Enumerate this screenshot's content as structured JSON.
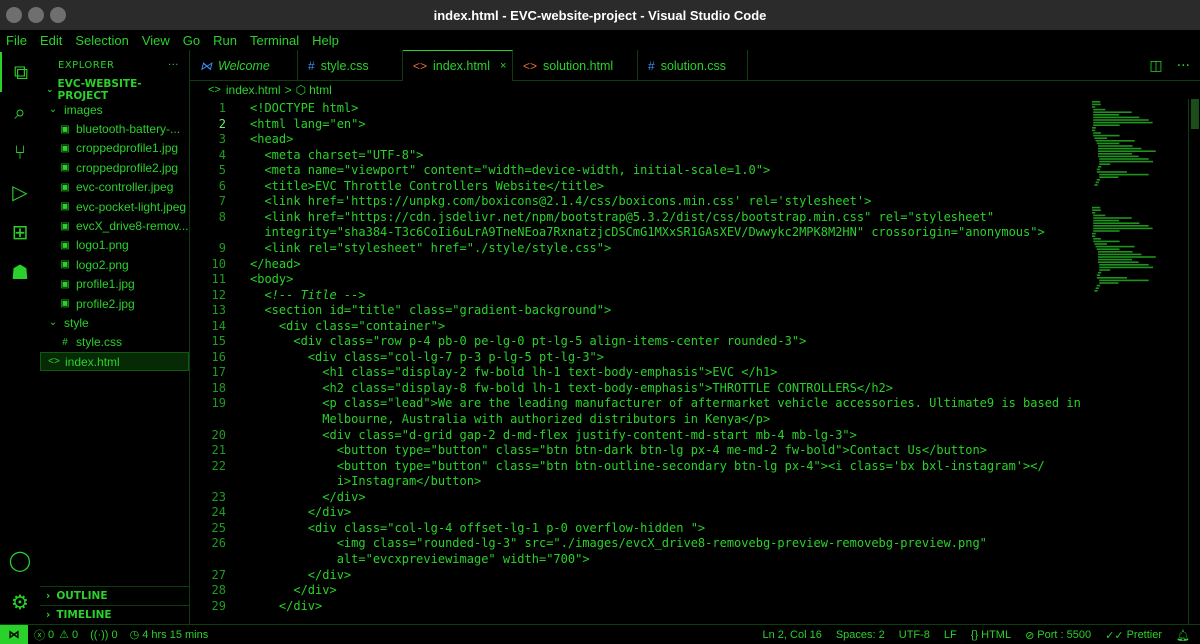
{
  "window": {
    "title": "index.html - EVC-website-project - Visual Studio Code"
  },
  "menu": [
    "File",
    "Edit",
    "Selection",
    "View",
    "Go",
    "Run",
    "Terminal",
    "Help"
  ],
  "activity": [
    {
      "name": "explorer-icon",
      "glyph": "⧉"
    },
    {
      "name": "search-icon",
      "glyph": "⌕"
    },
    {
      "name": "source-control-icon",
      "glyph": "⑂"
    },
    {
      "name": "run-debug-icon",
      "glyph": "▷"
    },
    {
      "name": "extensions-icon",
      "glyph": "⊞"
    },
    {
      "name": "alien-extension-icon",
      "glyph": "☗"
    }
  ],
  "activity_bottom": [
    {
      "name": "account-icon",
      "glyph": "◯"
    },
    {
      "name": "settings-gear-icon",
      "glyph": "⚙"
    }
  ],
  "sidebar": {
    "header": "EXPLORER",
    "more": "···",
    "project": "EVC-WEBSITE-PROJECT",
    "tree": [
      {
        "label": "images",
        "type": "folder",
        "depth": 1
      },
      {
        "label": "bluetooth-battery-...",
        "type": "image",
        "depth": 2
      },
      {
        "label": "croppedprofile1.jpg",
        "type": "image",
        "depth": 2
      },
      {
        "label": "croppedprofile2.jpg",
        "type": "image",
        "depth": 2
      },
      {
        "label": "evc-controller.jpeg",
        "type": "image",
        "depth": 2
      },
      {
        "label": "evc-pocket-light.jpeg",
        "type": "image",
        "depth": 2
      },
      {
        "label": "evcX_drive8-remov...",
        "type": "image",
        "depth": 2
      },
      {
        "label": "logo1.png",
        "type": "image",
        "depth": 2
      },
      {
        "label": "logo2.png",
        "type": "image",
        "depth": 2
      },
      {
        "label": "profile1.jpg",
        "type": "image",
        "depth": 2
      },
      {
        "label": "profile2.jpg",
        "type": "image",
        "depth": 2
      },
      {
        "label": "style",
        "type": "folder",
        "depth": 1
      },
      {
        "label": "style.css",
        "type": "css",
        "depth": 2
      },
      {
        "label": "index.html",
        "type": "html",
        "depth": 1,
        "selected": true
      }
    ],
    "outline": "OUTLINE",
    "timeline": "TIMELINE"
  },
  "tabs": [
    {
      "label": "Welcome",
      "icon": "vscode",
      "italic": true
    },
    {
      "label": "style.css",
      "icon": "#"
    },
    {
      "label": "index.html",
      "icon": "<>",
      "active": true,
      "close": "×"
    },
    {
      "label": "solution.html",
      "icon": "<>"
    },
    {
      "label": "solution.css",
      "icon": "#"
    }
  ],
  "breadcrumb": {
    "file": "index.html",
    "sep": ">",
    "symbol": "html"
  },
  "code": [
    {
      "n": "1",
      "t": "<!DOCTYPE html>"
    },
    {
      "n": "2",
      "t": "<html lang=\"en\">",
      "cur": true
    },
    {
      "n": "3",
      "t": "<head>"
    },
    {
      "n": "4",
      "t": "  <meta charset=\"UTF-8\">"
    },
    {
      "n": "5",
      "t": "  <meta name=\"viewport\" content=\"width=device-width, initial-scale=1.0\">"
    },
    {
      "n": "6",
      "t": "  <title>EVC Throttle Controllers Website</title>"
    },
    {
      "n": "7",
      "t": "  <link href='https://unpkg.com/boxicons@2.1.4/css/boxicons.min.css' rel='stylesheet'>"
    },
    {
      "n": "8",
      "t": "  <link href=\"https://cdn.jsdelivr.net/npm/bootstrap@5.3.2/dist/css/bootstrap.min.css\" rel=\"stylesheet\""
    },
    {
      "n": "",
      "t": "  integrity=\"sha384-T3c6CoIi6uLrA9TneNEoa7RxnatzjcDSCmG1MXxSR1GAsXEV/Dwwykc2MPK8M2HN\" crossorigin=\"anonymous\">"
    },
    {
      "n": "9",
      "t": "  <link rel=\"stylesheet\" href=\"./style/style.css\">"
    },
    {
      "n": "10",
      "t": "</head>"
    },
    {
      "n": "11",
      "t": "<body>"
    },
    {
      "n": "12",
      "t": "  <!-- Title -->",
      "comment": true
    },
    {
      "n": "13",
      "t": "  <section id=\"title\" class=\"gradient-background\">"
    },
    {
      "n": "14",
      "t": "    <div class=\"container\">"
    },
    {
      "n": "15",
      "t": "      <div class=\"row p-4 pb-0 pe-lg-0 pt-lg-5 align-items-center rounded-3\">"
    },
    {
      "n": "16",
      "t": "        <div class=\"col-lg-7 p-3 p-lg-5 pt-lg-3\">"
    },
    {
      "n": "17",
      "t": "          <h1 class=\"display-2 fw-bold lh-1 text-body-emphasis\">EVC </h1>"
    },
    {
      "n": "18",
      "t": "          <h2 class=\"display-8 fw-bold lh-1 text-body-emphasis\">THROTTLE CONTROLLERS</h2>"
    },
    {
      "n": "19",
      "t": "          <p class=\"lead\">We are the leading manufacturer of aftermarket vehicle accessories. Ultimate9 is based in"
    },
    {
      "n": "",
      "t": "          Melbourne, Australia with authorized distributors in Kenya</p>"
    },
    {
      "n": "20",
      "t": "          <div class=\"d-grid gap-2 d-md-flex justify-content-md-start mb-4 mb-lg-3\">"
    },
    {
      "n": "21",
      "t": "            <button type=\"button\" class=\"btn btn-dark btn-lg px-4 me-md-2 fw-bold\">Contact Us</button>"
    },
    {
      "n": "22",
      "t": "            <button type=\"button\" class=\"btn btn-outline-secondary btn-lg px-4\"><i class='bx bxl-instagram'></"
    },
    {
      "n": "",
      "t": "            i>Instagram</button>"
    },
    {
      "n": "23",
      "t": "          </div>"
    },
    {
      "n": "24",
      "t": "        </div>"
    },
    {
      "n": "25",
      "t": "        <div class=\"col-lg-4 offset-lg-1 p-0 overflow-hidden \">"
    },
    {
      "n": "26",
      "t": "            <img class=\"rounded-lg-3\" src=\"./images/evcX_drive8-removebg-preview-removebg-preview.png\""
    },
    {
      "n": "",
      "t": "            alt=\"evcxpreviewimage\" width=\"700\">"
    },
    {
      "n": "27",
      "t": "        </div>"
    },
    {
      "n": "28",
      "t": "      </div>"
    },
    {
      "n": "29",
      "t": "    </div>"
    }
  ],
  "status": {
    "errors": "0",
    "warnings": "0",
    "ports": "0",
    "time": "4 hrs 15 mins",
    "position": "Ln 2, Col 16",
    "spaces": "Spaces: 2",
    "encoding": "UTF-8",
    "eol": "LF",
    "language": "HTML",
    "port": "Port : 5500",
    "prettier": "Prettier"
  },
  "colors": {
    "accent": "#2bd12b",
    "background": "#000000",
    "titlebar": "#2b2b2b"
  }
}
